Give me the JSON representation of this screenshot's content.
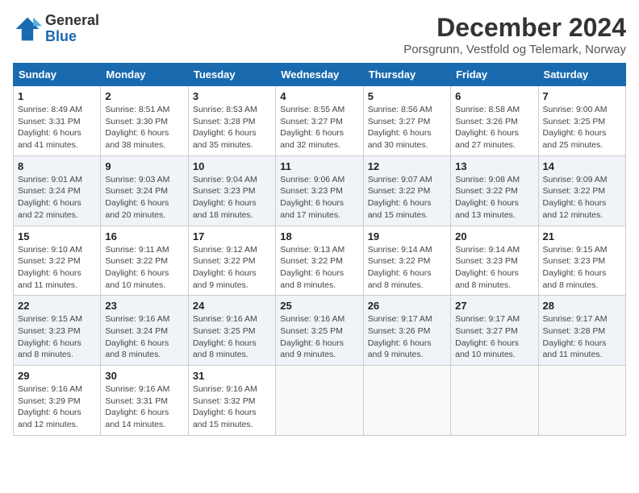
{
  "logo": {
    "line1": "General",
    "line2": "Blue"
  },
  "title": "December 2024",
  "subtitle": "Porsgrunn, Vestfold og Telemark, Norway",
  "days_of_week": [
    "Sunday",
    "Monday",
    "Tuesday",
    "Wednesday",
    "Thursday",
    "Friday",
    "Saturday"
  ],
  "weeks": [
    [
      {
        "day": 1,
        "info": "Sunrise: 8:49 AM\nSunset: 3:31 PM\nDaylight: 6 hours\nand 41 minutes."
      },
      {
        "day": 2,
        "info": "Sunrise: 8:51 AM\nSunset: 3:30 PM\nDaylight: 6 hours\nand 38 minutes."
      },
      {
        "day": 3,
        "info": "Sunrise: 8:53 AM\nSunset: 3:28 PM\nDaylight: 6 hours\nand 35 minutes."
      },
      {
        "day": 4,
        "info": "Sunrise: 8:55 AM\nSunset: 3:27 PM\nDaylight: 6 hours\nand 32 minutes."
      },
      {
        "day": 5,
        "info": "Sunrise: 8:56 AM\nSunset: 3:27 PM\nDaylight: 6 hours\nand 30 minutes."
      },
      {
        "day": 6,
        "info": "Sunrise: 8:58 AM\nSunset: 3:26 PM\nDaylight: 6 hours\nand 27 minutes."
      },
      {
        "day": 7,
        "info": "Sunrise: 9:00 AM\nSunset: 3:25 PM\nDaylight: 6 hours\nand 25 minutes."
      }
    ],
    [
      {
        "day": 8,
        "info": "Sunrise: 9:01 AM\nSunset: 3:24 PM\nDaylight: 6 hours\nand 22 minutes."
      },
      {
        "day": 9,
        "info": "Sunrise: 9:03 AM\nSunset: 3:24 PM\nDaylight: 6 hours\nand 20 minutes."
      },
      {
        "day": 10,
        "info": "Sunrise: 9:04 AM\nSunset: 3:23 PM\nDaylight: 6 hours\nand 18 minutes."
      },
      {
        "day": 11,
        "info": "Sunrise: 9:06 AM\nSunset: 3:23 PM\nDaylight: 6 hours\nand 17 minutes."
      },
      {
        "day": 12,
        "info": "Sunrise: 9:07 AM\nSunset: 3:22 PM\nDaylight: 6 hours\nand 15 minutes."
      },
      {
        "day": 13,
        "info": "Sunrise: 9:08 AM\nSunset: 3:22 PM\nDaylight: 6 hours\nand 13 minutes."
      },
      {
        "day": 14,
        "info": "Sunrise: 9:09 AM\nSunset: 3:22 PM\nDaylight: 6 hours\nand 12 minutes."
      }
    ],
    [
      {
        "day": 15,
        "info": "Sunrise: 9:10 AM\nSunset: 3:22 PM\nDaylight: 6 hours\nand 11 minutes."
      },
      {
        "day": 16,
        "info": "Sunrise: 9:11 AM\nSunset: 3:22 PM\nDaylight: 6 hours\nand 10 minutes."
      },
      {
        "day": 17,
        "info": "Sunrise: 9:12 AM\nSunset: 3:22 PM\nDaylight: 6 hours\nand 9 minutes."
      },
      {
        "day": 18,
        "info": "Sunrise: 9:13 AM\nSunset: 3:22 PM\nDaylight: 6 hours\nand 8 minutes."
      },
      {
        "day": 19,
        "info": "Sunrise: 9:14 AM\nSunset: 3:22 PM\nDaylight: 6 hours\nand 8 minutes."
      },
      {
        "day": 20,
        "info": "Sunrise: 9:14 AM\nSunset: 3:23 PM\nDaylight: 6 hours\nand 8 minutes."
      },
      {
        "day": 21,
        "info": "Sunrise: 9:15 AM\nSunset: 3:23 PM\nDaylight: 6 hours\nand 8 minutes."
      }
    ],
    [
      {
        "day": 22,
        "info": "Sunrise: 9:15 AM\nSunset: 3:23 PM\nDaylight: 6 hours\nand 8 minutes."
      },
      {
        "day": 23,
        "info": "Sunrise: 9:16 AM\nSunset: 3:24 PM\nDaylight: 6 hours\nand 8 minutes."
      },
      {
        "day": 24,
        "info": "Sunrise: 9:16 AM\nSunset: 3:25 PM\nDaylight: 6 hours\nand 8 minutes."
      },
      {
        "day": 25,
        "info": "Sunrise: 9:16 AM\nSunset: 3:25 PM\nDaylight: 6 hours\nand 9 minutes."
      },
      {
        "day": 26,
        "info": "Sunrise: 9:17 AM\nSunset: 3:26 PM\nDaylight: 6 hours\nand 9 minutes."
      },
      {
        "day": 27,
        "info": "Sunrise: 9:17 AM\nSunset: 3:27 PM\nDaylight: 6 hours\nand 10 minutes."
      },
      {
        "day": 28,
        "info": "Sunrise: 9:17 AM\nSunset: 3:28 PM\nDaylight: 6 hours\nand 11 minutes."
      }
    ],
    [
      {
        "day": 29,
        "info": "Sunrise: 9:16 AM\nSunset: 3:29 PM\nDaylight: 6 hours\nand 12 minutes."
      },
      {
        "day": 30,
        "info": "Sunrise: 9:16 AM\nSunset: 3:31 PM\nDaylight: 6 hours\nand 14 minutes."
      },
      {
        "day": 31,
        "info": "Sunrise: 9:16 AM\nSunset: 3:32 PM\nDaylight: 6 hours\nand 15 minutes."
      },
      null,
      null,
      null,
      null
    ]
  ]
}
